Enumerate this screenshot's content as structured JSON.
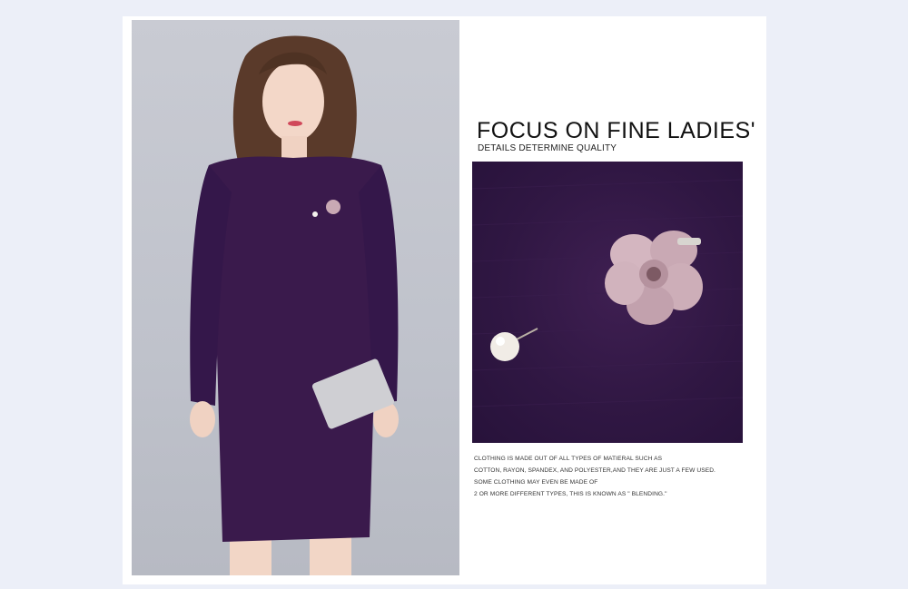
{
  "heading": "FOCUS ON FINE LADIES'",
  "subheading": "DETAILS DETERMINE QUALITY",
  "caption_lines": [
    "CLOTHING IS MADE OUT OF ALL TYPES OF MATIERAL SUCH AS",
    "COTTON, RAYON, SPANDEX, AND POLYESTER,AND THEY ARE JUST A FEW USED.",
    "SOME CLOTHING MAY EVEN BE MADE OF",
    "2 OR MORE DIFFERENT TYPES, THIS IS KNOWN AS \" BLENDING.\""
  ],
  "colors": {
    "background": "#eceff8",
    "dress": "#3a1a4c",
    "detail_fabric": "#301743",
    "flower": "#c9a9b4"
  },
  "images": {
    "model_photo": "model-photo",
    "detail_photo": "brooch-detail-photo"
  }
}
